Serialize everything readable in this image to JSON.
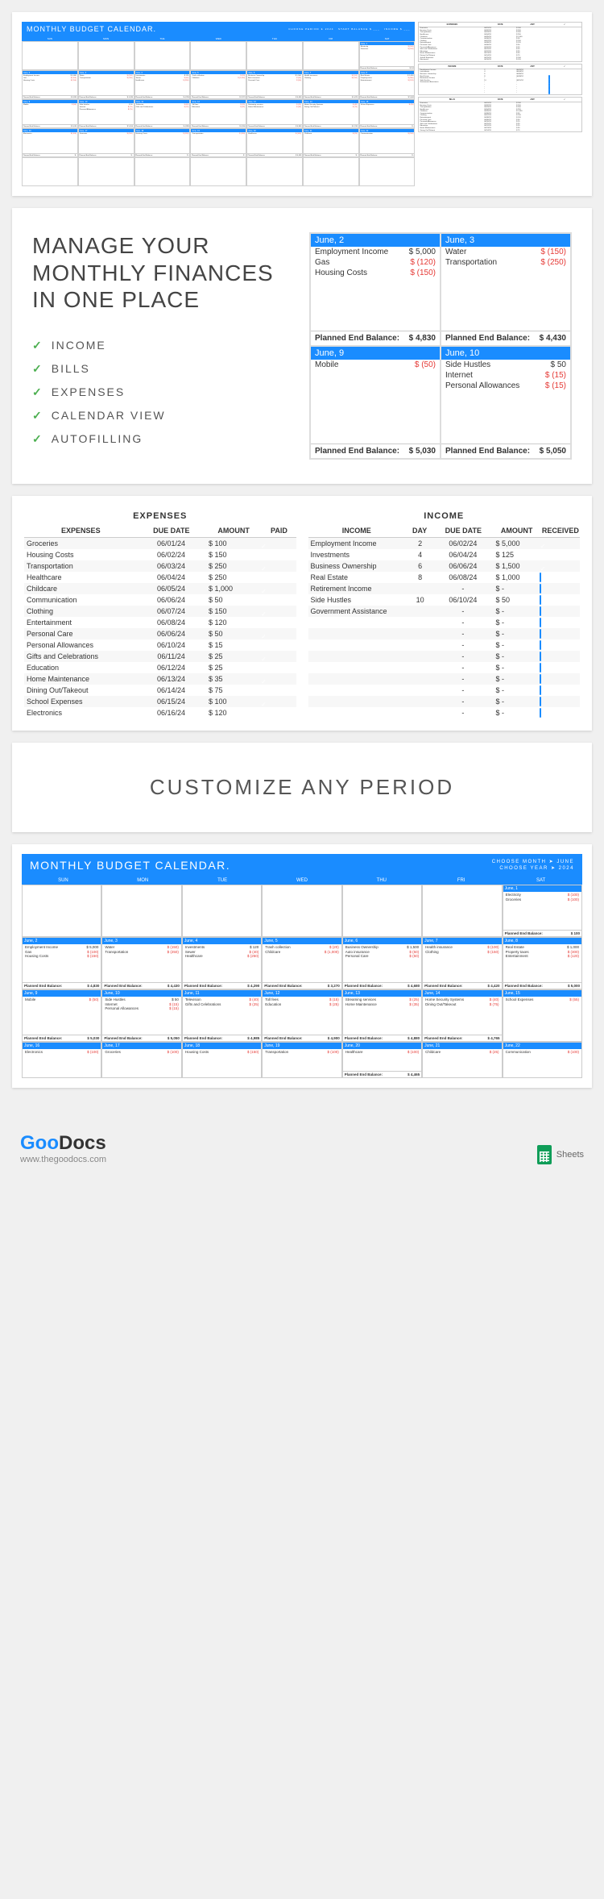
{
  "hero": {
    "title": "MONTHLY BUDGET CALENDAR.",
    "days": [
      "SUN",
      "MON",
      "TUE",
      "WED",
      "THU",
      "FRI",
      "SAT"
    ]
  },
  "features": {
    "heading": "MANAGE YOUR MONTHLY FINANCES IN ONE PLACE",
    "items": [
      "INCOME",
      "BILLS",
      "EXPENSES",
      "CALENDAR VIEW",
      "AUTOFILLING"
    ],
    "cards": [
      {
        "date": "June, 2",
        "rows": [
          [
            "Employment Income",
            "$ 5,000",
            ""
          ],
          [
            "Gas",
            "$ (120)",
            "neg"
          ],
          [
            "Housing Costs",
            "$ (150)",
            "neg"
          ]
        ],
        "balance": "$ 4,830"
      },
      {
        "date": "June, 3",
        "rows": [
          [
            "Water",
            "$ (150)",
            "neg"
          ],
          [
            "Transportation",
            "$ (250)",
            "neg"
          ]
        ],
        "balance": "$ 4,430"
      },
      {
        "date": "June, 9",
        "rows": [
          [
            "Mobile",
            "$ (50)",
            "neg"
          ]
        ],
        "balance": "$ 5,030"
      },
      {
        "date": "June, 10",
        "rows": [
          [
            "Side Hustles",
            "$ 50",
            ""
          ],
          [
            "Internet",
            "$ (15)",
            "neg"
          ],
          [
            "Personal Allowances",
            "$ (15)",
            "neg"
          ]
        ],
        "balance": "$ 5,050"
      }
    ],
    "peb_label": "Planned End Balance:"
  },
  "tables": {
    "expenses": {
      "title": "EXPENSES",
      "headers": [
        "EXPENSES",
        "DUE DATE",
        "AMOUNT",
        "PAID"
      ],
      "rows": [
        [
          "Groceries",
          "06/01/24",
          "$    100",
          true
        ],
        [
          "Housing Costs",
          "06/02/24",
          "$    150",
          true
        ],
        [
          "Transportation",
          "06/03/24",
          "$    250",
          true
        ],
        [
          "Healthcare",
          "06/04/24",
          "$    250",
          true
        ],
        [
          "Childcare",
          "06/05/24",
          "$  1,000",
          true
        ],
        [
          "Communication",
          "06/06/24",
          "$      50",
          true
        ],
        [
          "Clothing",
          "06/07/24",
          "$    150",
          true
        ],
        [
          "Entertainment",
          "06/08/24",
          "$    120",
          true
        ],
        [
          "Personal Care",
          "06/06/24",
          "$      50",
          true
        ],
        [
          "Personal Allowances",
          "06/10/24",
          "$      15",
          true
        ],
        [
          "Gifts and Celebrations",
          "06/11/24",
          "$      25",
          true
        ],
        [
          "Education",
          "06/12/24",
          "$      25",
          true
        ],
        [
          "Home Maintenance",
          "06/13/24",
          "$      35",
          true
        ],
        [
          "Dining Out/Takeout",
          "06/14/24",
          "$      75",
          true
        ],
        [
          "School Expenses",
          "06/15/24",
          "$    100",
          true
        ],
        [
          "Electronics",
          "06/16/24",
          "$    120",
          true
        ]
      ]
    },
    "income": {
      "title": "INCOME",
      "headers": [
        "INCOME",
        "DAY",
        "DUE DATE",
        "AMOUNT",
        "RECEIVED"
      ],
      "rows": [
        [
          "Employment Income",
          "2",
          "06/02/24",
          "$  5,000",
          true
        ],
        [
          "Investments",
          "4",
          "06/04/24",
          "$     125",
          true
        ],
        [
          "Business Ownership",
          "6",
          "06/06/24",
          "$  1,500",
          true
        ],
        [
          "Real Estate",
          "8",
          "06/08/24",
          "$  1,000",
          false
        ],
        [
          "Retirement Income",
          "",
          "-",
          "$         -",
          false
        ],
        [
          "Side Hustles",
          "10",
          "06/10/24",
          "$       50",
          false
        ],
        [
          "Government Assistance",
          "",
          "-",
          "$         -",
          false
        ],
        [
          "",
          "",
          "-",
          "$         -",
          false
        ],
        [
          "",
          "",
          "-",
          "$         -",
          false
        ],
        [
          "",
          "",
          "-",
          "$         -",
          false
        ],
        [
          "",
          "",
          "-",
          "$         -",
          false
        ],
        [
          "",
          "",
          "-",
          "$         -",
          false
        ],
        [
          "",
          "",
          "-",
          "$         -",
          false
        ],
        [
          "",
          "",
          "-",
          "$         -",
          false
        ],
        [
          "",
          "",
          "-",
          "$         -",
          false
        ],
        [
          "",
          "",
          "-",
          "$         -",
          false
        ]
      ]
    }
  },
  "custom_heading": "CUSTOMIZE ANY PERIOD",
  "bottom": {
    "title": "MONTHLY BUDGET CALENDAR.",
    "choose_month": "CHOOSE MONTH ➤    JUNE",
    "choose_year": "CHOOSE YEAR ➤    2024",
    "days": [
      "SUN",
      "MON",
      "TUE",
      "WED",
      "THU",
      "FRI",
      "SAT"
    ],
    "cells": [
      {
        "d": "",
        "rows": [],
        "bal": ""
      },
      {
        "d": "",
        "rows": [],
        "bal": ""
      },
      {
        "d": "",
        "rows": [],
        "bal": ""
      },
      {
        "d": "",
        "rows": [],
        "bal": ""
      },
      {
        "d": "",
        "rows": [],
        "bal": ""
      },
      {
        "d": "",
        "rows": [],
        "bal": ""
      },
      {
        "d": "June, 1",
        "rows": [
          [
            "Electricity",
            "$ (100)",
            "neg"
          ],
          [
            "Groceries",
            "$ (100)",
            "neg"
          ]
        ],
        "bal": "$ 100"
      },
      {
        "d": "June, 2",
        "rows": [
          [
            "Employment Income",
            "$ 5,000",
            ""
          ],
          [
            "Gas",
            "$ (100)",
            "neg"
          ],
          [
            "Housing Costs",
            "$ (150)",
            "neg"
          ]
        ],
        "bal": "$ 4,830"
      },
      {
        "d": "June, 3",
        "rows": [
          [
            "Water",
            "$ (150)",
            "neg"
          ],
          [
            "Transportation",
            "$ (250)",
            "neg"
          ]
        ],
        "bal": "$ 4,430"
      },
      {
        "d": "June, 4",
        "rows": [
          [
            "Investments",
            "$ 120",
            ""
          ],
          [
            "Sewer",
            "$ (40)",
            "neg"
          ],
          [
            "Healthcare",
            "$ (250)",
            "neg"
          ]
        ],
        "bal": "$ 4,290"
      },
      {
        "d": "June, 5",
        "rows": [
          [
            "Trash collection",
            "$ (20)",
            "neg"
          ],
          [
            "Childcare",
            "$ (1,000)",
            "neg"
          ]
        ],
        "bal": "$ 3,270"
      },
      {
        "d": "June, 6",
        "rows": [
          [
            "Business Ownership",
            "$ 1,500",
            ""
          ],
          [
            "Auto insurance",
            "$ (50)",
            "neg"
          ],
          [
            "Personal Care",
            "$ (50)",
            "neg"
          ]
        ],
        "bal": "$ 4,680"
      },
      {
        "d": "June, 7",
        "rows": [
          [
            "Health insurance",
            "$ (100)",
            "neg"
          ],
          [
            "Clothing",
            "$ (150)",
            "neg"
          ]
        ],
        "bal": "$ 4,420"
      },
      {
        "d": "June, 8",
        "rows": [
          [
            "Real Estate",
            "$ 1,000",
            ""
          ],
          [
            "Property taxes",
            "$ (300)",
            "neg"
          ],
          [
            "Entertainment",
            "$ (120)",
            "neg"
          ]
        ],
        "bal": "$ 5,000"
      },
      {
        "d": "June, 9",
        "rows": [
          [
            "Mobile",
            "$ (50)",
            "neg"
          ]
        ],
        "bal": "$ 5,030"
      },
      {
        "d": "June, 10",
        "rows": [
          [
            "Side Hustles",
            "$ 50",
            ""
          ],
          [
            "Internet",
            "$ (15)",
            "neg"
          ],
          [
            "Personal Allowances",
            "$ (15)",
            "neg"
          ]
        ],
        "bal": "$ 5,050"
      },
      {
        "d": "June, 11",
        "rows": [
          [
            "Television",
            "$ (40)",
            "neg"
          ],
          [
            "Gifts and Celebrations",
            "$ (25)",
            "neg"
          ]
        ],
        "bal": "$ 4,985"
      },
      {
        "d": "June, 12",
        "rows": [
          [
            "Toll fees",
            "$ (15)",
            "neg"
          ],
          [
            "Education",
            "$ (25)",
            "neg"
          ]
        ],
        "bal": "$ 4,900"
      },
      {
        "d": "June, 13",
        "rows": [
          [
            "Streaming services",
            "$ (25)",
            "neg"
          ],
          [
            "Home Maintenance",
            "$ (35)",
            "neg"
          ]
        ],
        "bal": "$ 4,880"
      },
      {
        "d": "June, 14",
        "rows": [
          [
            "Home Security Systems",
            "$ (40)",
            "neg"
          ],
          [
            "Dining Out/Takeout",
            "$ (75)",
            "neg"
          ]
        ],
        "bal": "$ 4,765"
      },
      {
        "d": "June, 15",
        "rows": [
          [
            "School Expenses",
            "$ (55)",
            "neg"
          ]
        ],
        "bal": ""
      },
      {
        "d": "June, 16",
        "rows": [
          [
            "Electronics",
            "$ (100)",
            "neg"
          ]
        ],
        "bal": ""
      },
      {
        "d": "June, 17",
        "rows": [
          [
            "Groceries",
            "$ (100)",
            "neg"
          ]
        ],
        "bal": ""
      },
      {
        "d": "June, 18",
        "rows": [
          [
            "Housing Costs",
            "$ (150)",
            "neg"
          ]
        ],
        "bal": ""
      },
      {
        "d": "June, 19",
        "rows": [
          [
            "Transportation",
            "$ (100)",
            "neg"
          ]
        ],
        "bal": ""
      },
      {
        "d": "June, 20",
        "rows": [
          [
            "Healthcare",
            "$ (100)",
            "neg"
          ]
        ],
        "bal": "$ 4,465"
      },
      {
        "d": "June, 21",
        "rows": [
          [
            "Childcare",
            "$ (25)",
            "neg"
          ]
        ],
        "bal": ""
      },
      {
        "d": "June, 22",
        "rows": [
          [
            "Communication",
            "$ (100)",
            "neg"
          ]
        ],
        "bal": ""
      }
    ]
  },
  "footer": {
    "logo_goo": "Goo",
    "logo_docs": "Docs",
    "url": "www.thegoodocs.com",
    "sheets": "Sheets"
  }
}
